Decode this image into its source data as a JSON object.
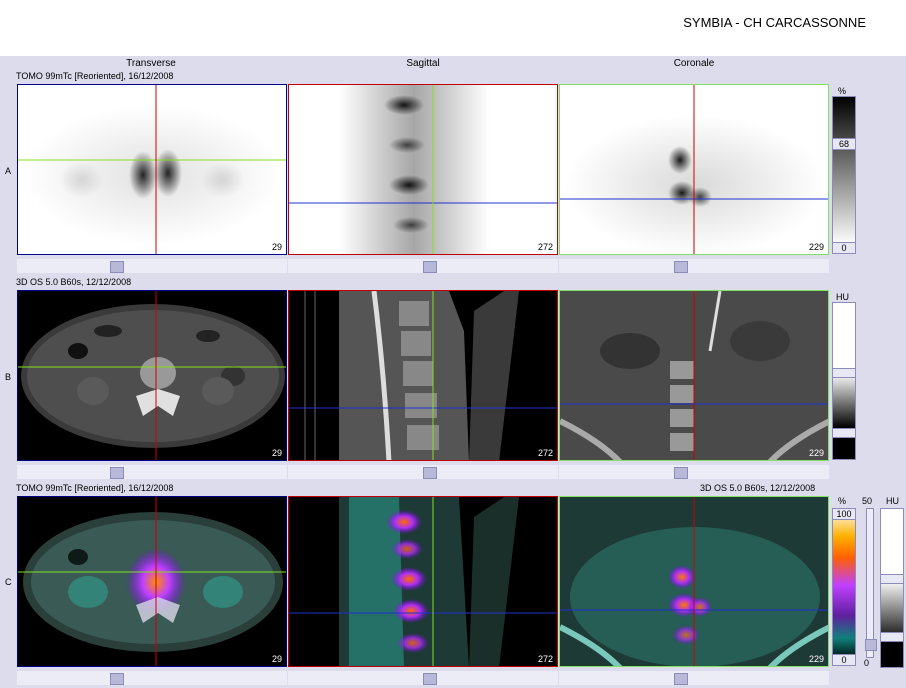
{
  "header": {
    "site": "SYMBIA - CH CARCASSONNE"
  },
  "columns": [
    "Transverse",
    "Sagittal",
    "Coronale"
  ],
  "rows": [
    {
      "label": "A",
      "info": "TOMO 99mTc [Reoriented], 16/12/2008",
      "slices": [
        "29",
        "272",
        "229"
      ]
    },
    {
      "label": "B",
      "info": "3D  OS  5.0  B60s, 12/12/2008",
      "slices": [
        "29",
        "272",
        "229"
      ]
    },
    {
      "label": "C",
      "info": "TOMO 99mTc [Reoriented], 16/12/2008",
      "info_right": "3D  OS  5.0  B60s, 12/12/2008",
      "slices": [
        "29",
        "272",
        "229"
      ]
    }
  ],
  "colorbars": {
    "a": {
      "unit": "%",
      "max": "68",
      "min": "0"
    },
    "b": {
      "unit": "HU"
    },
    "c": {
      "unit_pct": "%",
      "max_pct": "100",
      "min_pct": "0",
      "mid": "50",
      "unit_hu": "HU",
      "min_hu": "0"
    }
  },
  "colors": {
    "crosshair_red": "#d00000",
    "crosshair_green": "#80e020",
    "crosshair_blue": "#2030d0",
    "border_blue": "#0000a0",
    "border_red": "#c00000",
    "border_green": "#80e060"
  }
}
